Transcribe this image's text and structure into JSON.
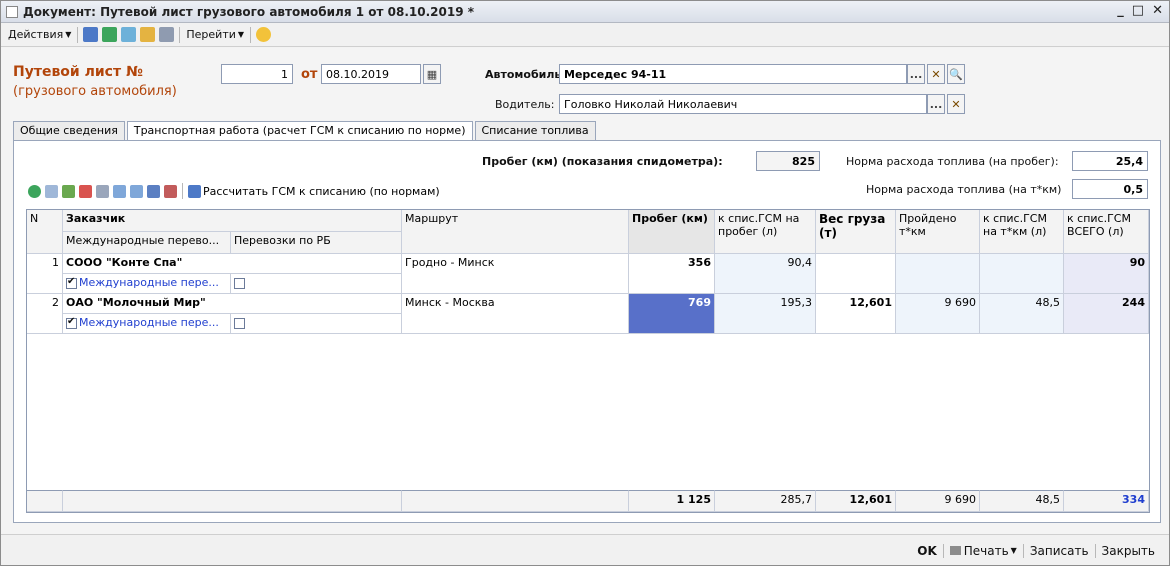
{
  "window": {
    "title": "Документ: Путевой лист грузового автомобиля 1 от 08.10.2019 *",
    "controls": [
      "_",
      "□",
      "✕"
    ]
  },
  "toolbar": {
    "actions_label": "Действия",
    "goto_label": "Перейти"
  },
  "header": {
    "title": "Путевой лист №",
    "subtitle": "(грузового автомобиля)",
    "number": "1",
    "from_label": "от",
    "date": "08.10.2019",
    "car_label": "Автомобиль:",
    "car_value": "Мерседес 94-11",
    "driver_label": "Водитель:",
    "driver_value": "Головко Николай Николаевич",
    "ellipsis": "...",
    "clear": "✕"
  },
  "tabs": [
    {
      "label": "Общие сведения",
      "active": false
    },
    {
      "label": "Транспортная работа (расчет ГСМ к списанию по норме)",
      "active": true
    },
    {
      "label": "Списание топлива",
      "active": false
    }
  ],
  "panel": {
    "mileage_label": "Пробег (км) (показания спидометра):",
    "mileage_value": "825",
    "norm_mileage_label": "Норма расхода топлива (на пробег):",
    "norm_mileage_value": "25,4",
    "norm_tkm_label": "Норма расхода топлива (на т*км)",
    "norm_tkm_value": "0,5",
    "calc_button": "Рассчитать ГСМ к списанию (по нормам)"
  },
  "grid": {
    "headers": {
      "n": "N",
      "customer": "Заказчик",
      "intl": "Международные перево...",
      "rb": "Перевозки по РБ",
      "route": "Маршрут",
      "mileage": "Пробег (км)",
      "fuel_mileage": "к спис.ГСМ на пробег (л)",
      "cargo_weight": "Вес груза (т)",
      "tkm": "Пройдено т*км",
      "fuel_tkm": "к спис.ГСМ на т*км (л)",
      "fuel_total": "к спис.ГСМ ВСЕГО (л)"
    },
    "rows": [
      {
        "n": "1",
        "customer": "СООО \"Конте Спа\"",
        "intl_label": "Международные пере...",
        "intl_checked": true,
        "rb_checked": false,
        "route": "Гродно - Минск",
        "mileage": "356",
        "fuel_mileage": "90,4",
        "cargo_weight": "",
        "tkm": "",
        "fuel_tkm": "",
        "fuel_total": "90"
      },
      {
        "n": "2",
        "customer": "ОАО \"Молочный Мир\"",
        "intl_label": "Международные пере...",
        "intl_checked": true,
        "rb_checked": false,
        "route": "Минск - Москва",
        "mileage": "769",
        "fuel_mileage": "195,3",
        "cargo_weight": "12,601",
        "tkm": "9 690",
        "fuel_tkm": "48,5",
        "fuel_total": "244"
      }
    ],
    "totals": {
      "mileage": "1 125",
      "fuel_mileage": "285,7",
      "cargo_weight": "12,601",
      "tkm": "9 690",
      "fuel_tkm": "48,5",
      "fuel_total": "334"
    }
  },
  "statusbar": {
    "ok": "OK",
    "print": "Печать",
    "save": "Записать",
    "close": "Закрыть"
  }
}
